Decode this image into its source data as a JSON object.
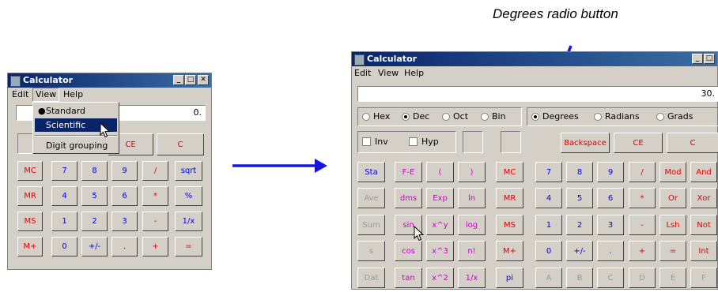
{
  "annotation": {
    "label": "Degrees radio button"
  },
  "small_window": {
    "title": "Calculator",
    "menu": [
      "Edit",
      "View",
      "Help"
    ],
    "display_value": "0.",
    "view_menu": {
      "items": [
        "Standard",
        "Scientific",
        "Digit grouping"
      ],
      "checked": "Standard",
      "highlighted": "Scientific"
    },
    "partial_buttons": [
      "CE",
      "C"
    ],
    "rows": [
      [
        "MC",
        "7",
        "8",
        "9",
        "/",
        "sqrt"
      ],
      [
        "MR",
        "4",
        "5",
        "6",
        "*",
        "%"
      ],
      [
        "MS",
        "1",
        "2",
        "3",
        "-",
        "1/x"
      ],
      [
        "M+",
        "0",
        "+/-",
        ".",
        "+",
        "="
      ]
    ]
  },
  "big_window": {
    "title": "Calculator",
    "menu": [
      "Edit",
      "View",
      "Help"
    ],
    "display_value": "30.",
    "bases": [
      "Hex",
      "Dec",
      "Oct",
      "Bin"
    ],
    "base_selected": "Dec",
    "angles": [
      "Degrees",
      "Radians",
      "Grads"
    ],
    "angle_selected": "Degrees",
    "checks": [
      "Inv",
      "Hyp"
    ],
    "top_buttons": [
      "Backspace",
      "CE",
      "C"
    ],
    "func_rows": [
      [
        "Sta",
        "F-E",
        "(",
        ")"
      ],
      [
        "Ave",
        "dms",
        "Exp",
        "ln"
      ],
      [
        "Sum",
        "sin",
        "x^y",
        "log"
      ],
      [
        "s",
        "cos",
        "x^3",
        "n!"
      ],
      [
        "Dat",
        "tan",
        "x^2",
        "1/x"
      ]
    ],
    "mem_col": [
      "MC",
      "MR",
      "MS",
      "M+",
      "pi"
    ],
    "num_rows": [
      [
        "7",
        "8",
        "9",
        "/",
        "Mod",
        "And"
      ],
      [
        "4",
        "5",
        "6",
        "*",
        "Or",
        "Xor"
      ],
      [
        "1",
        "2",
        "3",
        "-",
        "Lsh",
        "Not"
      ],
      [
        "0",
        "+/-",
        ".",
        "+",
        "=",
        "Int"
      ],
      [
        "A",
        "B",
        "C",
        "D",
        "E",
        "F"
      ]
    ]
  },
  "colors": {
    "accent_arrow": "#1515e0",
    "title_bar": "#0a246a"
  }
}
